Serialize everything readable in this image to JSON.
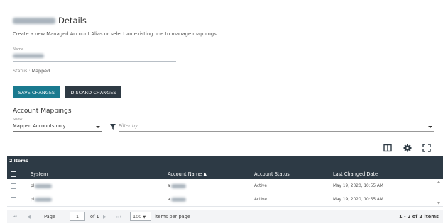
{
  "header": {
    "title": "Details"
  },
  "description": "Create a new Managed Account Alias or select an existing one to manage mappings.",
  "form": {
    "name_label": "Name",
    "status_label": "Status",
    "status_value": "Mapped"
  },
  "buttons": {
    "save": "SAVE CHANGES",
    "discard": "DISCARD CHANGES"
  },
  "mappings": {
    "title": "Account Mappings",
    "show_label": "Show",
    "show_value": "Mapped Accounts only",
    "filter_placeholder": "Filter by"
  },
  "toolbar_icons": [
    "columns-icon",
    "gear-icon",
    "fullscreen-icon"
  ],
  "grid": {
    "items_count": "2 items",
    "columns": [
      "System",
      "Account Name ▲",
      "Account Status",
      "Last Changed Date"
    ],
    "rows": [
      {
        "system": "pl",
        "account": "a",
        "status": "Active",
        "date": "May 19, 2020, 10:55 AM"
      },
      {
        "system": "pl",
        "account": "a",
        "status": "Active",
        "date": "May 19, 2020, 10:55 AM"
      }
    ]
  },
  "pager": {
    "page_label": "Page",
    "page_value": "1",
    "of_label": "of 1",
    "size_value": "100",
    "items_per_page": "items per page",
    "summary": "1 - 2 of 2 items"
  },
  "colors": {
    "accent": "#1a7a8f",
    "dark": "#2e3a44",
    "grid_header": "#2d3a45"
  }
}
